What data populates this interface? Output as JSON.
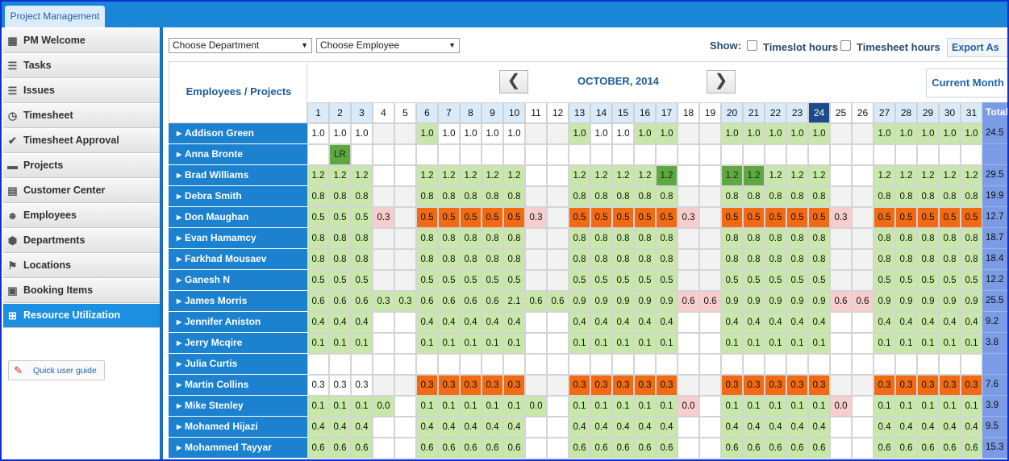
{
  "app_tab": "Project Management",
  "sidebar": {
    "items": [
      {
        "label": "PM Welcome",
        "icon": "grid-icon",
        "glyph": "▦"
      },
      {
        "label": "Tasks",
        "icon": "list-icon",
        "glyph": "☰"
      },
      {
        "label": "Issues",
        "icon": "list-icon",
        "glyph": "☰"
      },
      {
        "label": "Timesheet",
        "icon": "clock-icon",
        "glyph": "◷"
      },
      {
        "label": "Timesheet Approval",
        "icon": "check-circle-icon",
        "glyph": "✔"
      },
      {
        "label": "Projects",
        "icon": "folder-icon",
        "glyph": "▬"
      },
      {
        "label": "Customer Center",
        "icon": "contact-card-icon",
        "glyph": "▤"
      },
      {
        "label": "Employees",
        "icon": "person-icon",
        "glyph": "☻"
      },
      {
        "label": "Departments",
        "icon": "cube-icon",
        "glyph": "⬢"
      },
      {
        "label": "Locations",
        "icon": "flag-icon",
        "glyph": "⚑"
      },
      {
        "label": "Booking Items",
        "icon": "clipboard-icon",
        "glyph": "▣"
      },
      {
        "label": "Resource Utilization",
        "icon": "resource-grid-icon",
        "glyph": "⊞"
      }
    ],
    "active_index": 11,
    "quick_guide": "Quick user guide"
  },
  "toolbar": {
    "department_select": "Choose Department",
    "employee_select": "Choose Employee",
    "show_label": "Show:",
    "timeslot_label": "Timeslot hours",
    "timesheet_label": "Timesheet hours",
    "export_label": "Export As"
  },
  "calendar": {
    "corner_label": "Employees / Projects",
    "month_title": "OCTOBER, 2014",
    "prev_glyph": "❮",
    "next_glyph": "❯",
    "current_label": "Current Month",
    "total_header": "Total",
    "weekend_days": [
      4,
      5,
      11,
      12,
      18,
      19,
      25,
      26
    ],
    "today": 24,
    "colors": {
      "green": "#c7e8a8",
      "dark_green": "#5ea842",
      "orange": "#f26b12",
      "pink": "#f7cdcd",
      "weekend": "#f2f2f2",
      "blank": "#ffffff"
    }
  },
  "rows": [
    {
      "name": "Addison Green",
      "total": "24.5",
      "vals": [
        "1.0",
        "1.0",
        "1.0",
        "",
        "",
        "1.0",
        "1.0",
        "1.0",
        "1.0",
        "1.0",
        "",
        "",
        "1.0",
        "1.0",
        "1.0",
        "1.0",
        "1.0",
        "",
        "",
        "1.0",
        "1.0",
        "1.0",
        "1.0",
        "1.0",
        "",
        "",
        "1.0",
        "1.0",
        "1.0",
        "1.0",
        "1.0"
      ],
      "colors": [
        "w",
        "w",
        "w",
        "k",
        "k",
        "g",
        "w",
        "w",
        "w",
        "w",
        "k",
        "k",
        "g",
        "w",
        "w",
        "g",
        "g",
        "k",
        "k",
        "g",
        "g",
        "g",
        "g",
        "g",
        "k",
        "k",
        "g",
        "g",
        "g",
        "g",
        "g"
      ]
    },
    {
      "name": "Anna Bronte",
      "total": "",
      "vals": [
        "",
        "LR",
        "",
        "",
        "",
        "",
        "",
        "",
        "",
        "",
        "",
        "",
        "",
        "",
        "",
        "",
        "",
        "",
        "",
        "",
        "",
        "",
        "",
        "",
        "",
        "",
        "",
        "",
        "",
        "",
        ""
      ],
      "colors": [
        "w",
        "d",
        "w",
        "w",
        "w",
        "w",
        "w",
        "w",
        "w",
        "w",
        "w",
        "w",
        "w",
        "w",
        "w",
        "w",
        "w",
        "w",
        "w",
        "w",
        "w",
        "w",
        "w",
        "w",
        "w",
        "w",
        "w",
        "w",
        "w",
        "w",
        "w"
      ]
    },
    {
      "name": "Brad Williams",
      "total": "29.5",
      "vals": [
        "1.2",
        "1.2",
        "1.2",
        "",
        "",
        "1.2",
        "1.2",
        "1.2",
        "1.2",
        "1.2",
        "",
        "",
        "1.2",
        "1.2",
        "1.2",
        "1.2",
        "1.2",
        "",
        "",
        "1.2",
        "1.2",
        "1.2",
        "1.2",
        "1.2",
        "",
        "",
        "1.2",
        "1.2",
        "1.2",
        "1.2",
        "1.2"
      ],
      "colors": [
        "g",
        "g",
        "g",
        "w",
        "w",
        "g",
        "g",
        "g",
        "g",
        "g",
        "w",
        "w",
        "g",
        "g",
        "g",
        "g",
        "d",
        "w",
        "w",
        "d",
        "d",
        "g",
        "g",
        "g",
        "w",
        "w",
        "g",
        "g",
        "g",
        "g",
        "g"
      ]
    },
    {
      "name": "Debra Smith",
      "total": "19.9",
      "vals": [
        "0.8",
        "0.8",
        "0.8",
        "",
        "",
        "0.8",
        "0.8",
        "0.8",
        "0.8",
        "0.8",
        "",
        "",
        "0.8",
        "0.8",
        "0.8",
        "0.8",
        "0.8",
        "",
        "",
        "0.8",
        "0.8",
        "0.8",
        "0.8",
        "0.8",
        "",
        "",
        "0.8",
        "0.8",
        "0.8",
        "0.8",
        "0.8"
      ],
      "colors": [
        "g",
        "g",
        "g",
        "k",
        "k",
        "g",
        "g",
        "g",
        "g",
        "g",
        "k",
        "k",
        "g",
        "g",
        "g",
        "g",
        "g",
        "k",
        "k",
        "g",
        "g",
        "g",
        "g",
        "g",
        "k",
        "k",
        "g",
        "g",
        "g",
        "g",
        "g"
      ]
    },
    {
      "name": "Don Maughan",
      "total": "12.7",
      "vals": [
        "0.5",
        "0.5",
        "0.5",
        "0.3",
        "",
        "0.5",
        "0.5",
        "0.5",
        "0.5",
        "0.5",
        "0.3",
        "",
        "0.5",
        "0.5",
        "0.5",
        "0.5",
        "0.5",
        "0.3",
        "",
        "0.5",
        "0.5",
        "0.5",
        "0.5",
        "0.5",
        "0.3",
        "",
        "0.5",
        "0.5",
        "0.5",
        "0.5",
        "0.5"
      ],
      "colors": [
        "g",
        "g",
        "g",
        "p",
        "k",
        "o",
        "o",
        "o",
        "o",
        "o",
        "p",
        "k",
        "o",
        "o",
        "o",
        "o",
        "o",
        "p",
        "k",
        "o",
        "o",
        "o",
        "o",
        "o",
        "p",
        "k",
        "o",
        "o",
        "o",
        "o",
        "o"
      ]
    },
    {
      "name": "Evan Hamamcy",
      "total": "18.7",
      "vals": [
        "0.8",
        "0.8",
        "0.8",
        "",
        "",
        "0.8",
        "0.8",
        "0.8",
        "0.8",
        "0.8",
        "",
        "",
        "0.8",
        "0.8",
        "0.8",
        "0.8",
        "0.8",
        "",
        "",
        "0.8",
        "0.8",
        "0.8",
        "0.8",
        "0.8",
        "",
        "",
        "0.8",
        "0.8",
        "0.8",
        "0.8",
        "0.8"
      ],
      "colors": [
        "g",
        "g",
        "g",
        "k",
        "k",
        "g",
        "g",
        "g",
        "g",
        "g",
        "k",
        "k",
        "g",
        "g",
        "g",
        "g",
        "g",
        "k",
        "k",
        "g",
        "g",
        "g",
        "g",
        "g",
        "k",
        "k",
        "g",
        "g",
        "g",
        "g",
        "g"
      ]
    },
    {
      "name": "Farkhad Mousaev",
      "total": "18.4",
      "vals": [
        "0.8",
        "0.8",
        "0.8",
        "",
        "",
        "0.8",
        "0.8",
        "0.8",
        "0.8",
        "0.8",
        "",
        "",
        "0.8",
        "0.8",
        "0.8",
        "0.8",
        "0.8",
        "",
        "",
        "0.8",
        "0.8",
        "0.8",
        "0.8",
        "0.8",
        "",
        "",
        "0.8",
        "0.8",
        "0.8",
        "0.8",
        "0.8"
      ],
      "colors": [
        "g",
        "g",
        "g",
        "k",
        "k",
        "g",
        "g",
        "g",
        "g",
        "g",
        "k",
        "k",
        "g",
        "g",
        "g",
        "g",
        "g",
        "k",
        "k",
        "g",
        "g",
        "g",
        "g",
        "g",
        "k",
        "k",
        "g",
        "g",
        "g",
        "g",
        "g"
      ]
    },
    {
      "name": "Ganesh N",
      "total": "12.2",
      "vals": [
        "0.5",
        "0.5",
        "0.5",
        "",
        "",
        "0.5",
        "0.5",
        "0.5",
        "0.5",
        "0.5",
        "",
        "",
        "0.5",
        "0.5",
        "0.5",
        "0.5",
        "0.5",
        "",
        "",
        "0.5",
        "0.5",
        "0.5",
        "0.5",
        "0.5",
        "",
        "",
        "0.5",
        "0.5",
        "0.5",
        "0.5",
        "0.5"
      ],
      "colors": [
        "g",
        "g",
        "g",
        "k",
        "k",
        "g",
        "g",
        "g",
        "g",
        "g",
        "k",
        "k",
        "g",
        "g",
        "g",
        "g",
        "g",
        "k",
        "k",
        "g",
        "g",
        "g",
        "g",
        "g",
        "k",
        "k",
        "g",
        "g",
        "g",
        "g",
        "g"
      ]
    },
    {
      "name": "James Morris",
      "total": "25.5",
      "vals": [
        "0.6",
        "0.6",
        "0.6",
        "0.3",
        "0.3",
        "0.6",
        "0.6",
        "0.6",
        "0.6",
        "2.1",
        "0.6",
        "0.6",
        "0.9",
        "0.9",
        "0.9",
        "0.9",
        "0.9",
        "0.6",
        "0.6",
        "0.9",
        "0.9",
        "0.9",
        "0.9",
        "0.9",
        "0.6",
        "0.6",
        "0.9",
        "0.9",
        "0.9",
        "0.9",
        "0.9"
      ],
      "colors": [
        "g",
        "g",
        "g",
        "g",
        "g",
        "g",
        "g",
        "g",
        "g",
        "g",
        "g",
        "g",
        "g",
        "g",
        "g",
        "g",
        "g",
        "p",
        "p",
        "g",
        "g",
        "g",
        "g",
        "g",
        "p",
        "p",
        "g",
        "g",
        "g",
        "g",
        "g"
      ]
    },
    {
      "name": "Jennifer Aniston",
      "total": "9.2",
      "vals": [
        "0.4",
        "0.4",
        "0.4",
        "",
        "",
        "0.4",
        "0.4",
        "0.4",
        "0.4",
        "0.4",
        "",
        "",
        "0.4",
        "0.4",
        "0.4",
        "0.4",
        "0.4",
        "",
        "",
        "0.4",
        "0.4",
        "0.4",
        "0.4",
        "0.4",
        "",
        "",
        "0.4",
        "0.4",
        "0.4",
        "0.4",
        "0.4"
      ],
      "colors": [
        "g",
        "g",
        "g",
        "w",
        "w",
        "g",
        "g",
        "g",
        "g",
        "g",
        "w",
        "w",
        "g",
        "g",
        "g",
        "g",
        "g",
        "w",
        "w",
        "g",
        "g",
        "g",
        "g",
        "g",
        "w",
        "w",
        "g",
        "g",
        "g",
        "g",
        "g"
      ]
    },
    {
      "name": "Jerry Mcqire",
      "total": "3.8",
      "vals": [
        "0.1",
        "0.1",
        "0.1",
        "",
        "",
        "0.1",
        "0.1",
        "0.1",
        "0.1",
        "0.1",
        "",
        "",
        "0.1",
        "0.1",
        "0.1",
        "0.1",
        "0.1",
        "",
        "",
        "0.1",
        "0.1",
        "0.1",
        "0.1",
        "0.1",
        "",
        "",
        "0.1",
        "0.1",
        "0.1",
        "0.1",
        "0.1"
      ],
      "colors": [
        "g",
        "g",
        "g",
        "w",
        "w",
        "g",
        "g",
        "g",
        "g",
        "g",
        "w",
        "w",
        "g",
        "g",
        "g",
        "g",
        "g",
        "w",
        "w",
        "g",
        "g",
        "g",
        "g",
        "g",
        "w",
        "w",
        "g",
        "g",
        "g",
        "g",
        "g"
      ]
    },
    {
      "name": "Julia Curtis",
      "total": "",
      "vals": [
        "",
        "",
        "",
        "",
        "",
        "",
        "",
        "",
        "",
        "",
        "",
        "",
        "",
        "",
        "",
        "",
        "",
        "",
        "",
        "",
        "",
        "",
        "",
        "",
        "",
        "",
        "",
        "",
        "",
        "",
        ""
      ],
      "colors": [
        "w",
        "w",
        "w",
        "w",
        "w",
        "w",
        "w",
        "w",
        "w",
        "w",
        "w",
        "w",
        "w",
        "w",
        "w",
        "w",
        "w",
        "w",
        "w",
        "w",
        "w",
        "w",
        "w",
        "w",
        "w",
        "w",
        "w",
        "w",
        "w",
        "w",
        "w"
      ]
    },
    {
      "name": "Martin Collins",
      "total": "7.6",
      "vals": [
        "0.3",
        "0.3",
        "0.3",
        "",
        "",
        "0.3",
        "0.3",
        "0.3",
        "0.3",
        "0.3",
        "",
        "",
        "0.3",
        "0.3",
        "0.3",
        "0.3",
        "0.3",
        "",
        "",
        "0.3",
        "0.3",
        "0.3",
        "0.3",
        "0.3",
        "",
        "",
        "0.3",
        "0.3",
        "0.3",
        "0.3",
        "0.3"
      ],
      "colors": [
        "w",
        "w",
        "w",
        "k",
        "k",
        "o",
        "o",
        "o",
        "o",
        "o",
        "k",
        "k",
        "o",
        "o",
        "o",
        "o",
        "o",
        "k",
        "k",
        "o",
        "o",
        "o",
        "o",
        "o",
        "k",
        "k",
        "o",
        "o",
        "o",
        "o",
        "o"
      ]
    },
    {
      "name": "Mike Stenley",
      "total": "3.9",
      "vals": [
        "0.1",
        "0.1",
        "0.1",
        "0.0",
        "",
        "0.1",
        "0.1",
        "0.1",
        "0.1",
        "0.1",
        "0.0",
        "",
        "0.1",
        "0.1",
        "0.1",
        "0.1",
        "0.1",
        "0.0",
        "",
        "0.1",
        "0.1",
        "0.1",
        "0.1",
        "0.1",
        "0.0",
        "",
        "0.1",
        "0.1",
        "0.1",
        "0.1",
        "0.1"
      ],
      "colors": [
        "g",
        "g",
        "g",
        "g",
        "w",
        "g",
        "g",
        "g",
        "g",
        "g",
        "g",
        "w",
        "g",
        "g",
        "g",
        "g",
        "g",
        "p",
        "w",
        "g",
        "g",
        "g",
        "g",
        "g",
        "p",
        "w",
        "g",
        "g",
        "g",
        "g",
        "g"
      ]
    },
    {
      "name": "Mohamed Hijazi",
      "total": "9.5",
      "vals": [
        "0.4",
        "0.4",
        "0.4",
        "",
        "",
        "0.4",
        "0.4",
        "0.4",
        "0.4",
        "0.4",
        "",
        "",
        "0.4",
        "0.4",
        "0.4",
        "0.4",
        "0.4",
        "",
        "",
        "0.4",
        "0.4",
        "0.4",
        "0.4",
        "0.4",
        "",
        "",
        "0.4",
        "0.4",
        "0.4",
        "0.4",
        "0.4"
      ],
      "colors": [
        "g",
        "g",
        "g",
        "w",
        "w",
        "g",
        "g",
        "g",
        "g",
        "g",
        "w",
        "w",
        "g",
        "g",
        "g",
        "g",
        "g",
        "w",
        "w",
        "g",
        "g",
        "g",
        "g",
        "g",
        "w",
        "w",
        "g",
        "g",
        "g",
        "g",
        "g"
      ]
    },
    {
      "name": "Mohammed Tayyar",
      "total": "15.3",
      "vals": [
        "0.6",
        "0.6",
        "0.6",
        "",
        "",
        "0.6",
        "0.6",
        "0.6",
        "0.6",
        "0.6",
        "",
        "",
        "0.6",
        "0.6",
        "0.6",
        "0.6",
        "0.6",
        "",
        "",
        "0.6",
        "0.6",
        "0.6",
        "0.6",
        "0.6",
        "",
        "",
        "0.6",
        "0.6",
        "0.6",
        "0.6",
        "0.6"
      ],
      "colors": [
        "g",
        "g",
        "g",
        "w",
        "w",
        "g",
        "g",
        "g",
        "g",
        "g",
        "w",
        "w",
        "g",
        "g",
        "g",
        "g",
        "g",
        "w",
        "w",
        "g",
        "g",
        "g",
        "g",
        "g",
        "w",
        "w",
        "g",
        "g",
        "g",
        "g",
        "g"
      ]
    }
  ]
}
